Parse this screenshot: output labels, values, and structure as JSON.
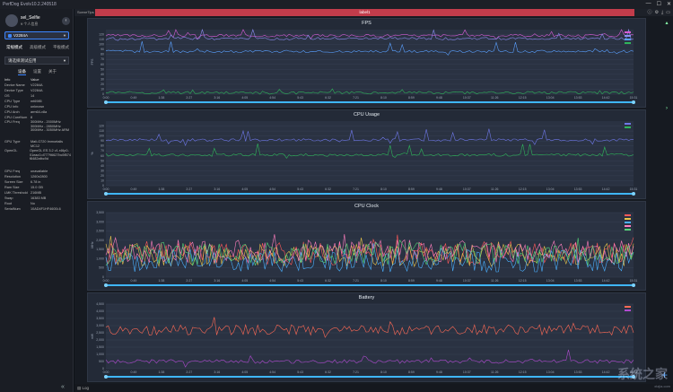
{
  "app": {
    "title": "PerfDog Evolv10.2.240518"
  },
  "window": {
    "minimize": "—",
    "maximize": "☐",
    "close": "✕"
  },
  "user": {
    "name": "sel_Selfie",
    "sub": "¥ 个人信息"
  },
  "device": {
    "name": "V2284A"
  },
  "mode_tabs": [
    "常规模式",
    "高级模式",
    "平板模式"
  ],
  "app_select": "请选择测试应用",
  "info_tabs": [
    "设备",
    "设置",
    "关于"
  ],
  "info": [
    [
      "Info",
      "Value"
    ],
    [
      "Device Name",
      "V2284A"
    ],
    [
      "Device Type",
      "V2284A"
    ],
    [
      "OS",
      "14"
    ],
    [
      "CPU Type",
      "mt6985"
    ],
    [
      "CPU Info",
      "unknown"
    ],
    [
      "CPU Arch",
      "arm64-v8a"
    ],
    [
      "CPU CoreNum",
      "8"
    ],
    [
      "CPU Freq",
      "300MHz - 2000MHz 300MHz - 2850MHz 300MHz - 3050MHz ARM"
    ],
    [
      "GPU Type",
      "Mali-G720 Immortalis MC12"
    ],
    [
      "OpenGL",
      "OpenGL ES 3.2 v1.r46p0-01eac0.d77796627bc5f574 f8482afbc9d"
    ],
    [
      "GPU Freq",
      "unavailable"
    ],
    [
      "Resolution",
      "1260x2800"
    ],
    [
      "Screen Size",
      "6.78 in"
    ],
    [
      "Ram Size",
      "15.0 GB"
    ],
    [
      "LMK Threshold",
      "216MB"
    ],
    [
      "Swap",
      "16383 MB"
    ],
    [
      "Root",
      "No"
    ],
    [
      "SerialNum",
      "10AD4F1HF4600L6"
    ]
  ],
  "toolbar": {
    "tab_label": "SceneTips",
    "label": "label1"
  },
  "bottom": {
    "log_label": "Log"
  },
  "watermark": {
    "text": "系统之家",
    "url": "xtzjia.com"
  },
  "colors": {
    "accent": "#3d86ff",
    "label": "#c23c4b",
    "panel": "#232a37"
  },
  "chart_data": [
    {
      "type": "line",
      "title": "FPS",
      "ylim": [
        0,
        130
      ],
      "yticks": [
        0,
        10,
        20,
        30,
        40,
        50,
        60,
        70,
        80,
        90,
        100,
        110,
        120
      ],
      "xticks": [
        "0:00",
        "0:49",
        "1:38",
        "2:27",
        "3:16",
        "4:05",
        "4:54",
        "5:43",
        "6:32",
        "7:21",
        "8:10",
        "8:59",
        "9:48",
        "10:37",
        "11:26",
        "12:15",
        "13:04",
        "13:53",
        "14:42",
        "15:31"
      ],
      "ylabel": "FPS",
      "series": [
        {
          "color": "#d65cd6",
          "level": 118
        },
        {
          "color": "#8a8cf0",
          "level": 112
        },
        {
          "color": "#5aa0ff",
          "level": 86
        },
        {
          "color": "#2fb55a",
          "level": 3
        }
      ]
    },
    {
      "type": "line",
      "title": "CPU Usage",
      "ylim": [
        0,
        130
      ],
      "yticks": [
        0,
        10,
        20,
        30,
        40,
        50,
        60,
        70,
        80,
        90,
        100,
        110,
        120
      ],
      "xticks": [
        "0:00",
        "0:49",
        "1:38",
        "2:27",
        "3:16",
        "4:05",
        "4:54",
        "5:43",
        "6:32",
        "7:21",
        "8:10",
        "8:59",
        "9:48",
        "10:37",
        "11:26",
        "12:15",
        "13:04",
        "13:53",
        "14:42",
        "15:31"
      ],
      "ylabel": "%",
      "series": [
        {
          "color": "#6f78e8",
          "level": 92
        },
        {
          "color": "#2fb55a",
          "level": 62
        }
      ]
    },
    {
      "type": "line",
      "title": "CPU Clock",
      "ylim": [
        0,
        3500
      ],
      "yticks": [
        0,
        500,
        1000,
        1500,
        2000,
        2500,
        3000,
        3500
      ],
      "xticks": [
        "0:00",
        "0:49",
        "1:38",
        "2:27",
        "3:16",
        "4:05",
        "4:54",
        "5:43",
        "6:32",
        "7:21",
        "8:10",
        "8:59",
        "9:48",
        "10:37",
        "11:26",
        "12:15",
        "13:04",
        "13:53",
        "14:42",
        "15:31"
      ],
      "ylabel": "MHz",
      "series": [
        {
          "color": "#ff5a5a",
          "level": 1300
        },
        {
          "color": "#e6c34a",
          "level": 1200
        },
        {
          "color": "#4ab0ff",
          "level": 900
        },
        {
          "color": "#ff7fbf",
          "level": 1400
        },
        {
          "color": "#55d477",
          "level": 1250
        }
      ]
    },
    {
      "type": "line",
      "title": "Battery",
      "ylim": [
        0,
        4500
      ],
      "yticks": [
        0,
        500,
        1000,
        1500,
        2000,
        2500,
        3000,
        3500,
        4000,
        4500
      ],
      "xticks": [
        "0:00",
        "0:49",
        "1:38",
        "2:27",
        "3:16",
        "4:05",
        "4:54",
        "5:43",
        "6:32",
        "7:21",
        "8:10",
        "8:59",
        "9:48",
        "10:37",
        "11:26",
        "12:15",
        "13:04",
        "13:53",
        "14:42",
        "15:31"
      ],
      "ylabel": "mW",
      "series": [
        {
          "color": "#ff6a55",
          "level": 2700
        },
        {
          "color": "#b04ad0",
          "level": 500
        }
      ]
    }
  ]
}
